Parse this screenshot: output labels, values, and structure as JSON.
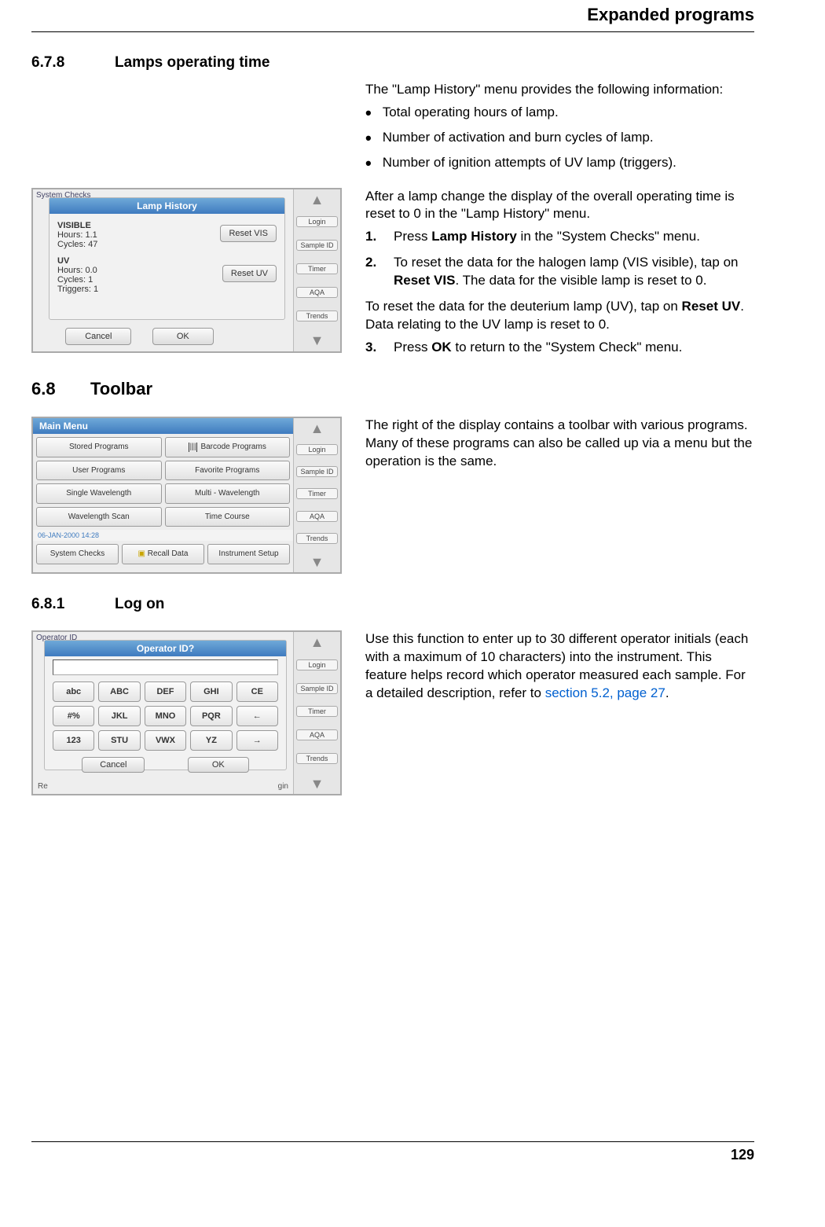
{
  "header": {
    "title": "Expanded programs"
  },
  "sections": {
    "s1": {
      "num": "6.7.8",
      "title": "Lamps operating time"
    },
    "s2": {
      "num": "6.8",
      "title": "Toolbar"
    },
    "s3": {
      "num": "6.8.1",
      "title": "Log on"
    }
  },
  "intro": {
    "p1": "The \"Lamp History\" menu provides the following information:",
    "bullets": [
      "Total operating hours of lamp.",
      "Number of activation and burn cycles of lamp.",
      "Number of ignition attempts of UV lamp (triggers)."
    ]
  },
  "block1": {
    "p1": "After a lamp change the display of the overall operating time is reset to 0 in the \"Lamp History\" menu.",
    "step1_pre": "Press ",
    "step1_bold": "Lamp History",
    "step1_post": " in the \"System Checks\" menu.",
    "step2_pre": "To reset the data for the halogen lamp (VIS visible), tap on ",
    "step2_bold": "Reset VIS",
    "step2_post": ". The data for the visible lamp is reset to 0.",
    "step2_para2_pre": "To reset the data for the deuterium lamp (UV), tap on ",
    "step2_para2_bold": "Reset UV",
    "step2_para2_post": ". Data relating to the UV lamp is reset to 0.",
    "step3_pre": "Press ",
    "step3_bold": "OK",
    "step3_post": " to return to the \"System Check\" menu."
  },
  "block2": {
    "p1": "The right of the display contains a toolbar with various programs. Many of these programs can also be called up via a menu but the operation is the same."
  },
  "block3": {
    "p_pre": "Use this function to enter up to 30 different operator initials (each with a maximum of 10 characters) into the instrument. This feature helps record which operator measured each sample. For a detailed description, refer to ",
    "p_link": "section 5.2, page 27",
    "p_post": "."
  },
  "mock_lamp": {
    "title": "Lamp History",
    "bg_title": "System Checks",
    "visible_label": "VISIBLE",
    "visible_hours": "Hours: 1.1",
    "visible_cycles": "Cycles: 47",
    "reset_vis": "Reset VIS",
    "uv_label": "UV",
    "uv_hours": "Hours: 0.0",
    "uv_cycles": "Cycles: 1",
    "uv_triggers": "Triggers: 1",
    "reset_uv": "Reset UV",
    "cancel": "Cancel",
    "ok": "OK"
  },
  "mock_main": {
    "title": "Main Menu",
    "buttons": [
      "Stored Programs",
      "Barcode Programs",
      "User Programs",
      "Favorite Programs",
      "Single Wavelength",
      "Multi - Wavelength",
      "Wavelength Scan",
      "Time Course"
    ],
    "date": "06-JAN-2000  14:28",
    "bottom": [
      "System Checks",
      "Recall Data",
      "Instrument Setup"
    ]
  },
  "mock_operator": {
    "title": "Operator ID?",
    "bg_title": "Operator ID",
    "keys_row1": [
      "abc",
      "ABC",
      "DEF",
      "GHI",
      "CE"
    ],
    "keys_row2": [
      "#%",
      "JKL",
      "MNO",
      "PQR",
      "←"
    ],
    "keys_row3": [
      "123",
      "STU",
      "VWX",
      "YZ",
      "→"
    ],
    "cancel": "Cancel",
    "ok": "OK",
    "footer_left": "Re",
    "footer_right": "gin"
  },
  "toolbar": {
    "login": "Login",
    "sample": "Sample ID",
    "timer": "Timer",
    "aqa": "AQA",
    "trends": "Trends"
  },
  "footer": {
    "page": "129"
  }
}
